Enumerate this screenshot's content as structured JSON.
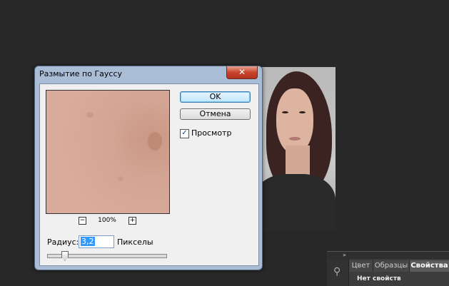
{
  "dialog": {
    "title": "Размытие по Гауссу",
    "close_label": "✕",
    "ok_label": "OK",
    "cancel_label": "Отмена",
    "preview_check_label": "Просмотр",
    "preview_checked": true,
    "zoom": "100%",
    "zoom_out": "−",
    "zoom_in": "+",
    "radius_label": "Радиус:",
    "radius_value": "3,2",
    "radius_units": "Пикселы",
    "slider_level": 0.14
  },
  "panel": {
    "collapse": "»",
    "tabs": [
      {
        "label": "Цвет",
        "active": false
      },
      {
        "label": "Образцы",
        "active": false
      },
      {
        "label": "Свойства",
        "active": true
      }
    ],
    "message": "Нет свойств"
  }
}
